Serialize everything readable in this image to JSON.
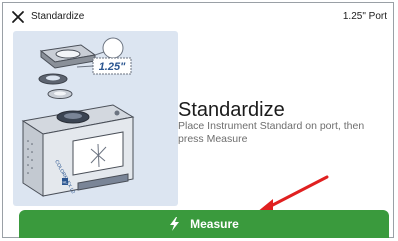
{
  "header": {
    "title": "Standardize",
    "port": "1.25\" Port",
    "close_icon": "close-icon"
  },
  "illustration": {
    "port_size_label": "1.25\"",
    "device_brand": "COLORFLEX L2",
    "device_badge": "HL"
  },
  "content": {
    "title": "Standardize",
    "instruction": "Place Instrument Standard on port, then press Measure"
  },
  "measure_button": {
    "label": "Measure",
    "icon": "lightning-bolt-icon",
    "color": "#3a9a3d"
  },
  "annotation": {
    "arrow_color": "#e02020"
  }
}
